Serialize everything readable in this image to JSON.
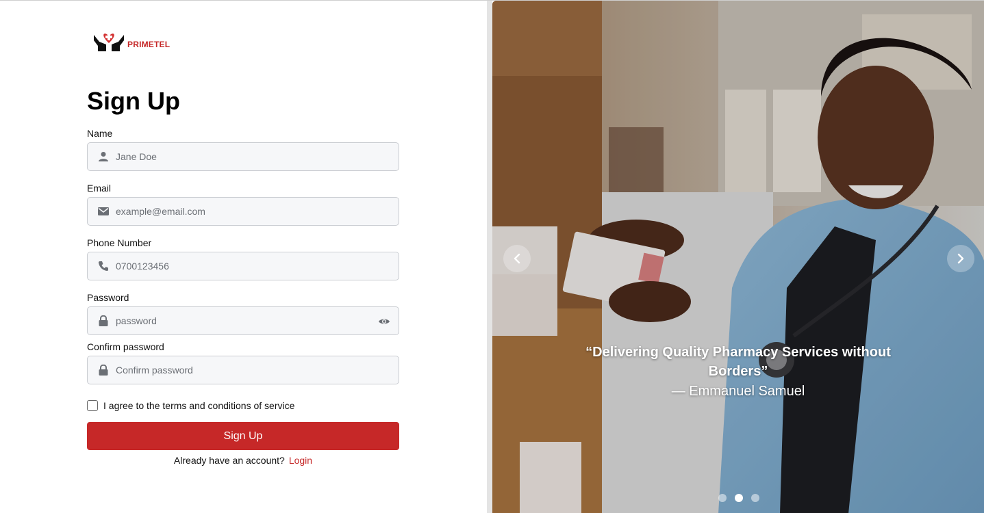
{
  "brand": {
    "name": "PRIMETEL",
    "accent": "#c62828"
  },
  "form": {
    "title": "Sign Up",
    "fields": [
      {
        "label": "Name",
        "placeholder": "Jane Doe",
        "icon": "user-icon",
        "type": "text"
      },
      {
        "label": "Email",
        "placeholder": "example@email.com",
        "icon": "envelope-icon",
        "type": "email"
      },
      {
        "label": "Phone Number",
        "placeholder": "0700123456",
        "icon": "phone-icon",
        "type": "tel"
      },
      {
        "label": "Password",
        "placeholder": "password",
        "icon": "lock-icon",
        "type": "password",
        "toggle_icon": "eye-icon"
      },
      {
        "label": "Confirm password",
        "placeholder": "Confirm password",
        "icon": "lock-icon",
        "type": "password"
      }
    ],
    "terms_label": "I agree to the terms and conditions of service",
    "submit_label": "Sign Up",
    "account_prompt": "Already have an account?",
    "login_label": "Login"
  },
  "carousel": {
    "quote": "“Delivering Quality Pharmacy Services without Borders”",
    "author": "— Emmanuel Samuel",
    "prev_icon": "chevron-left-icon",
    "next_icon": "chevron-right-icon",
    "slide_count": 3,
    "active_slide": 2
  }
}
